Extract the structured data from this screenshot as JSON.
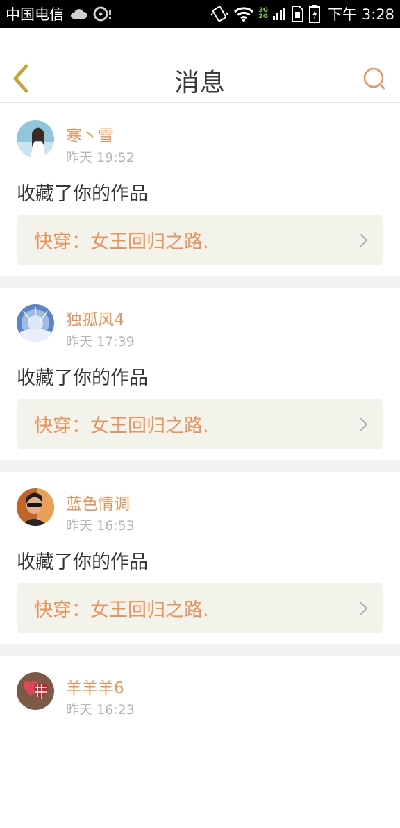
{
  "status_bar": {
    "carrier": "中国电信",
    "network_top": "3G",
    "network_bottom": "2G",
    "time": "下午 3:28"
  },
  "header": {
    "title": "消息",
    "back_icon": "chevron-left-icon",
    "search_icon": "search-icon"
  },
  "colors": {
    "accent": "#e8935a",
    "back_accent": "#c8a43a",
    "work_box_bg": "#f3f3ec",
    "divider": "#f2f2f2"
  },
  "messages": [
    {
      "username": "寒丶雪",
      "time": "昨天 19:52",
      "action": "收藏了你的作品",
      "work_title": "快穿：女王回归之路."
    },
    {
      "username": "独孤风4",
      "time": "昨天 17:39",
      "action": "收藏了你的作品",
      "work_title": "快穿：女王回归之路."
    },
    {
      "username": "蓝色情调",
      "time": "昨天 16:53",
      "action": "收藏了你的作品",
      "work_title": "快穿：女王回归之路."
    },
    {
      "username": "羊羊羊6",
      "time": "昨天 16:23"
    }
  ]
}
